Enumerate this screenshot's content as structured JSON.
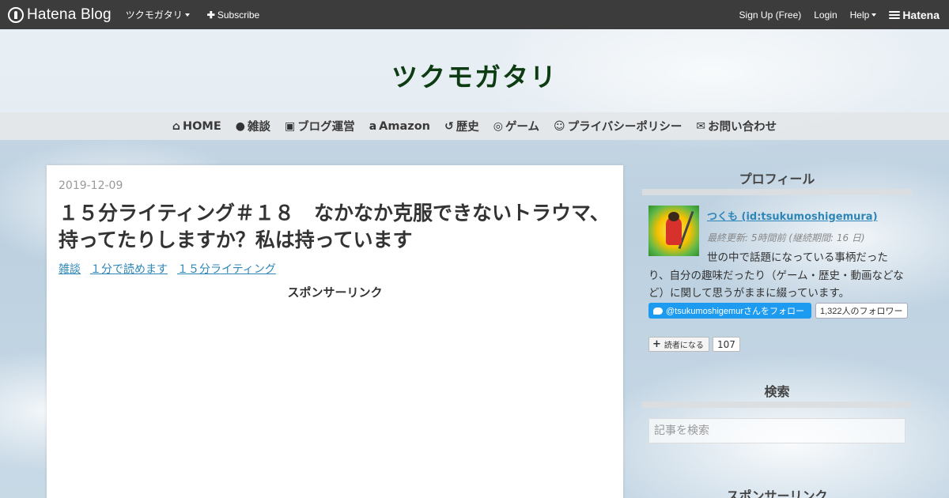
{
  "globalbar": {
    "logo": "Hatena Blog",
    "blog_menu": "ツクモガタリ",
    "subscribe": "Subscribe",
    "signup": "Sign Up (Free)",
    "login": "Login",
    "help": "Help",
    "hatena": "Hatena"
  },
  "header": {
    "title": "ツクモガタリ"
  },
  "nav": {
    "items": [
      {
        "icon": "home-icon",
        "label": "HOME"
      },
      {
        "icon": "comment-icon",
        "label": "雑談"
      },
      {
        "icon": "blogger-icon",
        "label": "ブログ運営"
      },
      {
        "icon": "amazon-icon",
        "label": "Amazon"
      },
      {
        "icon": "history-icon",
        "label": "歴史"
      },
      {
        "icon": "gamepad-icon",
        "label": "ゲーム"
      },
      {
        "icon": "smile-icon",
        "label": "プライバシーポリシー"
      },
      {
        "icon": "envelope-icon",
        "label": "お問い合わせ"
      }
    ]
  },
  "article": {
    "date": "2019-12-09",
    "title": "１５分ライティング＃１８　なかなか克服できないトラウマ、持ってたりしますか？私は持っています",
    "categories": [
      "雑談",
      "１分で読めます",
      "１５分ライティング"
    ],
    "sponsor": "スポンサーリンク"
  },
  "sidebar": {
    "profile": {
      "heading": "プロフィール",
      "name": "つくも (id:tsukumoshigemura)",
      "updated": "最終更新: 5時間前 (継続期間: 16 日)",
      "description": "世の中で話題になっている事柄だったり、自分の趣味だったり（ゲーム・歴史・動画などなど）に関して思うがままに綴っています。",
      "twitter_follow": "@tsukumoshigemurさんをフォロー",
      "twitter_followers": "1,322人のフォロワー",
      "subscribe_label": "読者になる",
      "subscribe_count": "107"
    },
    "search": {
      "heading": "検索",
      "placeholder": "記事を検索"
    },
    "sponsor_heading": "スポンサーリンク"
  }
}
